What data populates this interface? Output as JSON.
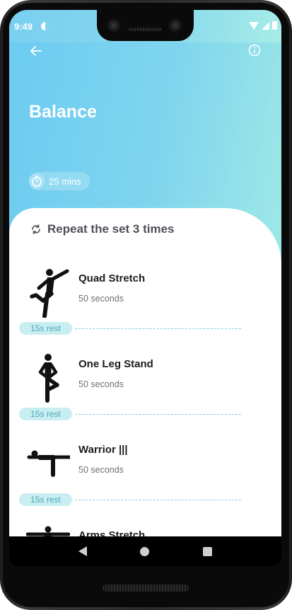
{
  "status_bar": {
    "time": "9:49"
  },
  "header": {
    "title": "Balance",
    "duration": "25 mins"
  },
  "repeat_text": "Repeat the set 3 times",
  "exercises": [
    {
      "name": "Quad Stretch",
      "duration": "50 seconds",
      "rest": "15s rest"
    },
    {
      "name": "One Leg Stand",
      "duration": "50 seconds",
      "rest": "15s rest"
    },
    {
      "name": "Warrior |||",
      "duration": "50 seconds",
      "rest": "15s rest"
    },
    {
      "name": "Arms Stretch"
    }
  ],
  "icons": {
    "back": "arrow-left-icon",
    "info": "info-icon",
    "timer": "stopwatch-icon",
    "repeat": "repeat-icon"
  },
  "colors": {
    "header_start": "#6ccbf1",
    "header_end": "#9ee8e6",
    "rest_bg": "#c9eef1",
    "rest_text": "#4aa7b8"
  }
}
